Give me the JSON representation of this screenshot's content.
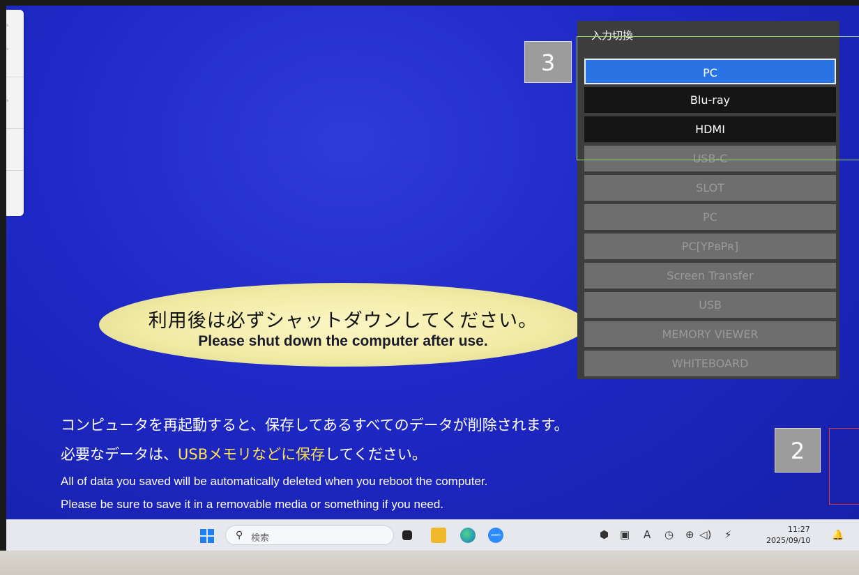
{
  "input_menu": {
    "title": "入力切換",
    "items": [
      {
        "label": "PC",
        "state": "selected"
      },
      {
        "label": "Blu-ray",
        "state": "enabled"
      },
      {
        "label": "HDMI",
        "state": "enabled"
      },
      {
        "label": "USB-C",
        "state": "disabled"
      },
      {
        "label": "SLOT",
        "state": "disabled"
      },
      {
        "label": "PC",
        "state": "disabled"
      },
      {
        "label": "PC[YPʙPʀ]",
        "state": "disabled"
      },
      {
        "label": "Screen Transfer",
        "state": "disabled"
      },
      {
        "label": "USB",
        "state": "disabled"
      },
      {
        "label": "MEMORY VIEWER",
        "state": "disabled"
      },
      {
        "label": "WHITEBOARD",
        "state": "disabled"
      }
    ]
  },
  "notice": {
    "jp_title": "利用後は必ずシャットダウンしてください。",
    "en_title": "Please shut down the computer after use."
  },
  "message": {
    "jp_line1": "コンピュータを再起動すると、保存してあるすべてのデータが削除されます。",
    "jp_line2_prefix": "必要なデータは、",
    "jp_line2_highlight": "USBメモリなどに保存",
    "jp_line2_suffix": "してください。",
    "en_line1": "All of data you saved will be automatically deleted when you reboot the computer.",
    "en_line2": "Please be sure to save it in a removable media or something if you need."
  },
  "annotations": {
    "badge_3": "3",
    "badge_2": "2"
  },
  "taskbar": {
    "search_placeholder": "検索",
    "zoom_label": "zoom",
    "tray_ime": "A",
    "clock_time": "11:27",
    "clock_date": "2025/09/10"
  },
  "colors": {
    "desktop_blue": "#1e28c4",
    "menu_selected": "#2a73e4",
    "highlight_yellow": "#ffe34d",
    "annotation_green": "#9be06a",
    "annotation_red": "#e23a3a"
  }
}
